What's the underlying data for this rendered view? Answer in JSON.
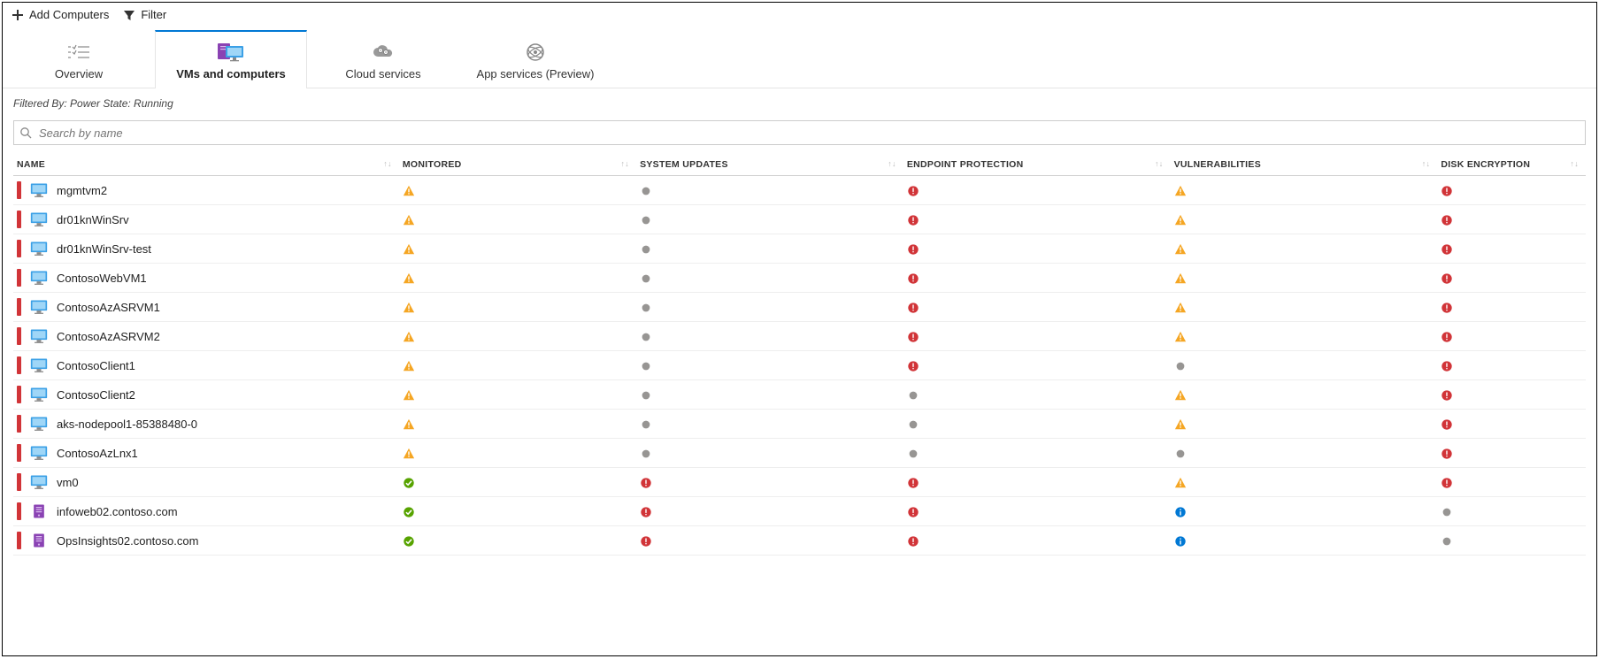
{
  "toolbar": {
    "add_label": "Add Computers",
    "filter_label": "Filter"
  },
  "tabs": [
    {
      "id": "overview",
      "label": "Overview"
    },
    {
      "id": "vms",
      "label": "VMs and computers",
      "active": true
    },
    {
      "id": "cloud",
      "label": "Cloud services"
    },
    {
      "id": "apps",
      "label": "App services (Preview)"
    }
  ],
  "filter_text": "Filtered By: Power State: Running",
  "search": {
    "placeholder": "Search by name",
    "value": ""
  },
  "columns": {
    "name": "NAME",
    "monitored": "MONITORED",
    "updates": "SYSTEM UPDATES",
    "ep": "ENDPOINT PROTECTION",
    "vuln": "VULNERABILITIES",
    "disk": "DISK ENCRYPTION"
  },
  "status_legend": {
    "warn": "warning",
    "error": "error",
    "ok": "healthy",
    "grey": "unknown",
    "info": "info"
  },
  "resource_types": {
    "vm": "azure-vm",
    "server": "on-prem-server"
  },
  "rows": [
    {
      "name": "mgmtvm2",
      "type": "vm",
      "monitored": "warn",
      "updates": "grey",
      "ep": "error",
      "vuln": "warn",
      "disk": "error"
    },
    {
      "name": "dr01knWinSrv",
      "type": "vm",
      "monitored": "warn",
      "updates": "grey",
      "ep": "error",
      "vuln": "warn",
      "disk": "error"
    },
    {
      "name": "dr01knWinSrv-test",
      "type": "vm",
      "monitored": "warn",
      "updates": "grey",
      "ep": "error",
      "vuln": "warn",
      "disk": "error"
    },
    {
      "name": "ContosoWebVM1",
      "type": "vm",
      "monitored": "warn",
      "updates": "grey",
      "ep": "error",
      "vuln": "warn",
      "disk": "error"
    },
    {
      "name": "ContosoAzASRVM1",
      "type": "vm",
      "monitored": "warn",
      "updates": "grey",
      "ep": "error",
      "vuln": "warn",
      "disk": "error"
    },
    {
      "name": "ContosoAzASRVM2",
      "type": "vm",
      "monitored": "warn",
      "updates": "grey",
      "ep": "error",
      "vuln": "warn",
      "disk": "error"
    },
    {
      "name": "ContosoClient1",
      "type": "vm",
      "monitored": "warn",
      "updates": "grey",
      "ep": "error",
      "vuln": "grey",
      "disk": "error"
    },
    {
      "name": "ContosoClient2",
      "type": "vm",
      "monitored": "warn",
      "updates": "grey",
      "ep": "grey",
      "vuln": "warn",
      "disk": "error"
    },
    {
      "name": "aks-nodepool1-85388480-0",
      "type": "vm",
      "monitored": "warn",
      "updates": "grey",
      "ep": "grey",
      "vuln": "warn",
      "disk": "error"
    },
    {
      "name": "ContosoAzLnx1",
      "type": "vm",
      "monitored": "warn",
      "updates": "grey",
      "ep": "grey",
      "vuln": "grey",
      "disk": "error"
    },
    {
      "name": "vm0",
      "type": "vm",
      "monitored": "ok",
      "updates": "error",
      "ep": "error",
      "vuln": "warn",
      "disk": "error"
    },
    {
      "name": "infoweb02.contoso.com",
      "type": "server",
      "monitored": "ok",
      "updates": "error",
      "ep": "error",
      "vuln": "info",
      "disk": "grey"
    },
    {
      "name": "OpsInsights02.contoso.com",
      "type": "server",
      "monitored": "ok",
      "updates": "error",
      "ep": "error",
      "vuln": "info",
      "disk": "grey"
    }
  ]
}
